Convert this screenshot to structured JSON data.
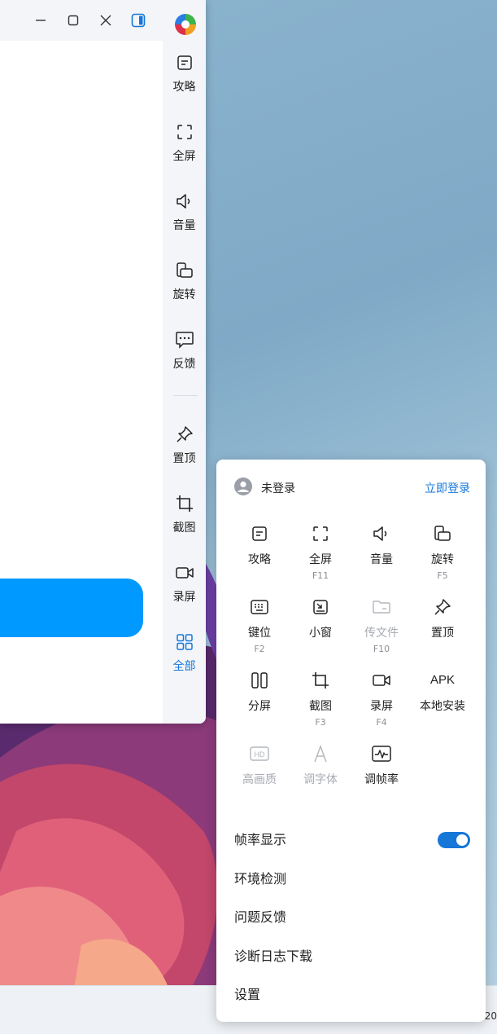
{
  "sidebar": {
    "items": [
      {
        "label": "攻略",
        "icon": "guide-icon"
      },
      {
        "label": "全屏",
        "icon": "fullscreen-icon"
      },
      {
        "label": "音量",
        "icon": "volume-icon"
      },
      {
        "label": "旋转",
        "icon": "rotate-icon"
      },
      {
        "label": "反馈",
        "icon": "feedback-icon"
      },
      {
        "label": "置顶",
        "icon": "pin-icon"
      },
      {
        "label": "截图",
        "icon": "crop-icon"
      },
      {
        "label": "录屏",
        "icon": "record-icon"
      },
      {
        "label": "全部",
        "icon": "all-grid-icon"
      }
    ]
  },
  "panel": {
    "user": {
      "status": "未登录",
      "login": "立即登录"
    },
    "grid": [
      {
        "label": "攻略",
        "key": "",
        "icon": "guide-icon",
        "enabled": true
      },
      {
        "label": "全屏",
        "key": "F11",
        "icon": "fullscreen-icon",
        "enabled": true
      },
      {
        "label": "音量",
        "key": "",
        "icon": "volume-icon",
        "enabled": true
      },
      {
        "label": "旋转",
        "key": "F5",
        "icon": "rotate-icon",
        "enabled": true
      },
      {
        "label": "键位",
        "key": "F2",
        "icon": "keyboard-icon",
        "enabled": true
      },
      {
        "label": "小窗",
        "key": "",
        "icon": "mini-window-icon",
        "enabled": true
      },
      {
        "label": "传文件",
        "key": "F10",
        "icon": "folder-icon",
        "enabled": false
      },
      {
        "label": "置顶",
        "key": "",
        "icon": "pin-icon",
        "enabled": true
      },
      {
        "label": "分屏",
        "key": "",
        "icon": "split-screen-icon",
        "enabled": true
      },
      {
        "label": "截图",
        "key": "F3",
        "icon": "crop-icon",
        "enabled": true
      },
      {
        "label": "录屏",
        "key": "F4",
        "icon": "record-icon",
        "enabled": true
      },
      {
        "label": "本地安装",
        "key": "",
        "icon": "apk-icon",
        "icon_text": "APK",
        "enabled": true
      },
      {
        "label": "高画质",
        "key": "",
        "icon": "hd-icon",
        "icon_text": "HD",
        "enabled": false
      },
      {
        "label": "调字体",
        "key": "",
        "icon": "font-icon",
        "icon_text": "A",
        "enabled": false
      },
      {
        "label": "调帧率",
        "key": "",
        "icon": "framerate-icon",
        "enabled": true
      }
    ],
    "menu": [
      {
        "label": "帧率显示",
        "toggle": true,
        "on": true
      },
      {
        "label": "环境检测"
      },
      {
        "label": "问题反馈"
      },
      {
        "label": "诊断日志下载"
      },
      {
        "label": "设置"
      }
    ]
  },
  "taskbar": {
    "clock_fragment": "20"
  },
  "colors": {
    "accent": "#1677d9",
    "screen_button": "#0099ff"
  }
}
